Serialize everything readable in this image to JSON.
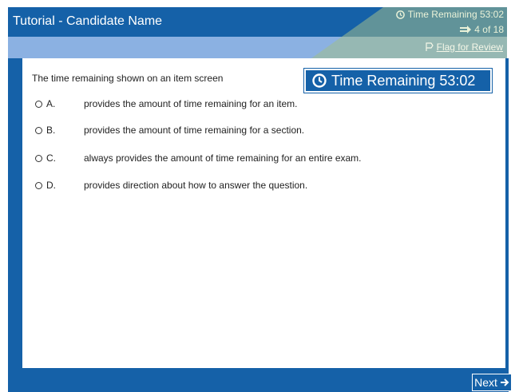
{
  "header": {
    "title": "Tutorial - Candidate Name",
    "time_remaining": "Time Remaining 53:02",
    "item_count": "4 of 18",
    "flag_label": "Flag for Review"
  },
  "callout": {
    "time_remaining": "Time Remaining 53:02"
  },
  "question": {
    "stem": "The time remaining shown on an item screen",
    "options": [
      {
        "letter": "A.",
        "text": "provides the amount of time remaining for an item."
      },
      {
        "letter": "B.",
        "text": "provides the amount of time remaining for a section."
      },
      {
        "letter": "C.",
        "text": "always provides the amount of time remaining for an entire exam."
      },
      {
        "letter": "D.",
        "text": "provides direction about how to answer the question."
      }
    ]
  },
  "footer": {
    "next_label": "Next"
  },
  "colors": {
    "primary": "#1561a8",
    "subbar": "#8bb1e2"
  }
}
